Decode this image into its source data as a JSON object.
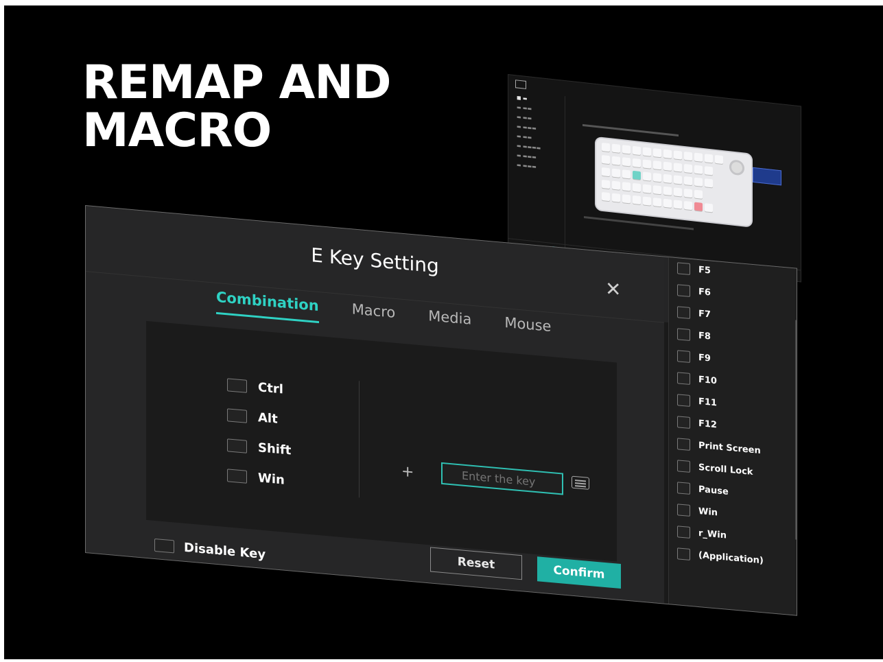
{
  "hero": {
    "line1": "REMAP AND",
    "line2": "MACRO"
  },
  "dialog": {
    "title": "E Key Setting",
    "tabs": [
      {
        "label": "Combination",
        "active": true
      },
      {
        "label": "Macro",
        "active": false
      },
      {
        "label": "Media",
        "active": false
      },
      {
        "label": "Mouse",
        "active": false
      }
    ],
    "modifiers": [
      "Ctrl",
      "Alt",
      "Shift",
      "Win"
    ],
    "plus": "+",
    "key_input": {
      "placeholder": "Enter the key",
      "value": ""
    },
    "reset_label": "Reset",
    "confirm_label": "Confirm",
    "disable_label": "Disable Key"
  },
  "key_list": [
    "F5",
    "F6",
    "F7",
    "F8",
    "F9",
    "F10",
    "F11",
    "F12",
    "Print Screen",
    "Scroll Lock",
    "Pause",
    "Win",
    "r_Win",
    "(Application)"
  ],
  "colors": {
    "accent": "#2fd2c4",
    "confirm": "#20b0a4",
    "background": "#000000",
    "panel": "#262627"
  }
}
